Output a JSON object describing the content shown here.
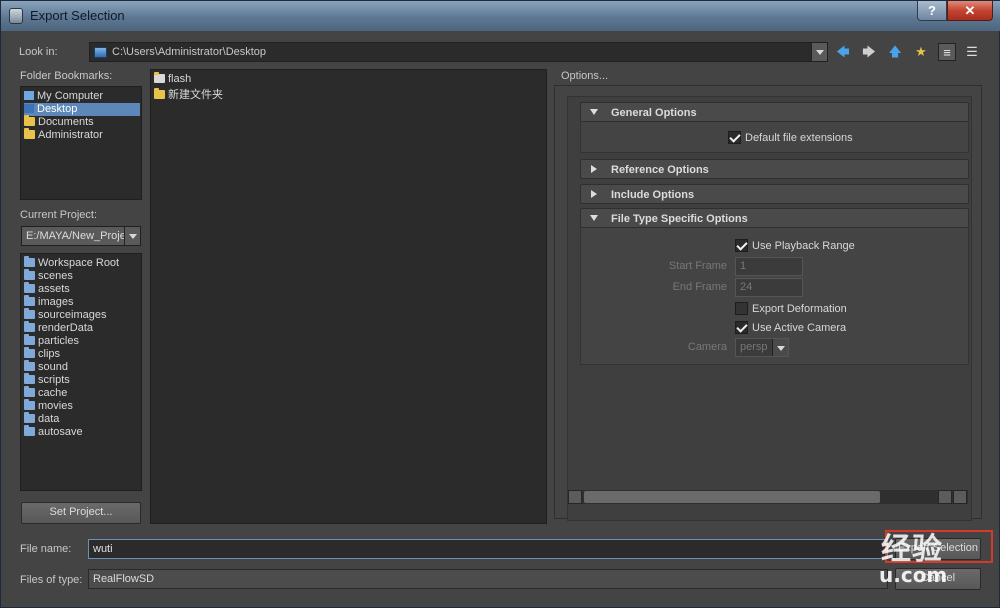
{
  "window": {
    "title": "Export Selection",
    "help_label": "?",
    "close_label": "✕"
  },
  "look_in": {
    "label": "Look in:",
    "path": "C:\\Users\\Administrator\\Desktop"
  },
  "nav": {
    "back": "🡄",
    "forward": "🡆",
    "up": "🡅",
    "new_folder": "★"
  },
  "bookmarks": {
    "label": "Folder Bookmarks:",
    "items": [
      {
        "label": "My Computer",
        "selected": false
      },
      {
        "label": "Desktop",
        "selected": true
      },
      {
        "label": "Documents",
        "selected": false
      },
      {
        "label": "Administrator",
        "selected": false
      }
    ]
  },
  "project": {
    "label": "Current Project:",
    "value": "E:/MAYA/New_Proje",
    "folders": [
      "Workspace Root",
      "scenes",
      "assets",
      "images",
      "sourceimages",
      "renderData",
      "particles",
      "clips",
      "sound",
      "scripts",
      "cache",
      "movies",
      "data",
      "autosave"
    ],
    "set_button": "Set Project..."
  },
  "files": [
    {
      "name": "flash"
    },
    {
      "name": "新建文件夹"
    }
  ],
  "options": {
    "label": "Options...",
    "general": {
      "title": "General Options",
      "default_ext": "Default file extensions"
    },
    "reference": {
      "title": "Reference Options"
    },
    "include": {
      "title": "Include Options"
    },
    "filetype": {
      "title": "File Type Specific Options",
      "playback": "Use Playback Range",
      "start_label": "Start Frame",
      "start_value": "1",
      "end_label": "End Frame",
      "end_value": "24",
      "export_deformation": "Export Deformation",
      "active_camera": "Use Active Camera",
      "camera_label": "Camera",
      "camera_value": "persp"
    }
  },
  "filename": {
    "label": "File name:",
    "value": "wuti"
  },
  "filetype": {
    "label": "Files of type:",
    "value": "RealFlowSD"
  },
  "buttons": {
    "export": "Export Selection",
    "cancel": "Cancel"
  },
  "watermark": {
    "line1": "经验",
    "line2": "u.com"
  }
}
